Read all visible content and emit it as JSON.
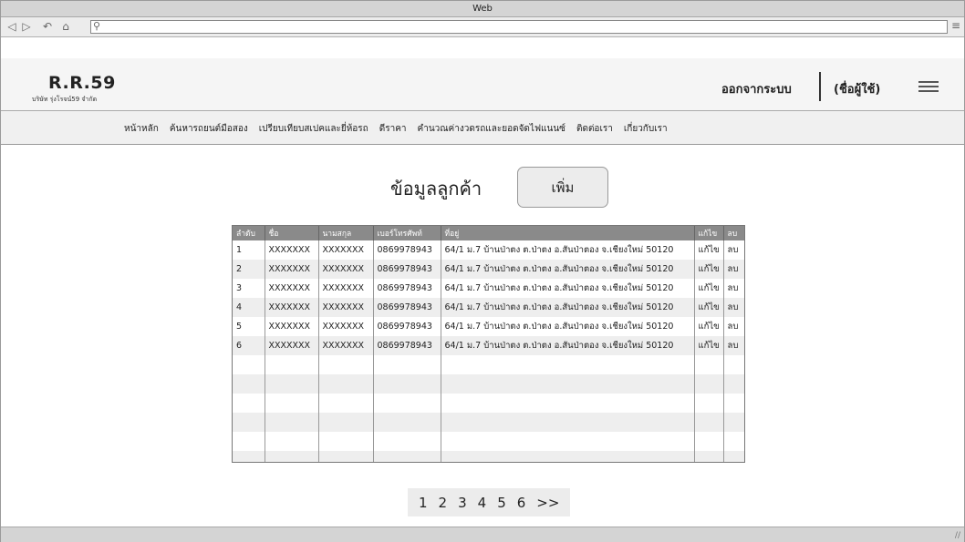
{
  "window": {
    "title": "Web"
  },
  "urlbar": {
    "value": ""
  },
  "header": {
    "logo_title": "R.R.59",
    "logo_subtitle": "บริษัท รุ่งโรจน์59 จำกัด",
    "logout_label": "ออกจากระบบ",
    "username_label": "(ชื่อผู้ใช้)"
  },
  "nav": {
    "items": [
      {
        "label": "หน้าหลัก"
      },
      {
        "label": "ค้นหารถยนต์มือสอง"
      },
      {
        "label": "เปรียบเทียบสเปคและยี่ห้อรถ"
      },
      {
        "label": "ดีราคา"
      },
      {
        "label": "คำนวณค่างวดรถและยอดจัดไฟแนนซ์"
      },
      {
        "label": "ติดต่อเรา"
      },
      {
        "label": "เกี่ยวกับเรา"
      }
    ]
  },
  "main": {
    "title": "ข้อมูลลูกค้า",
    "add_button_label": "เพิ่ม"
  },
  "table": {
    "columns": [
      "ลำดับ",
      "ชื่อ",
      "นามสกุล",
      "เบอร์โทรศัพท์",
      "ที่อยู่",
      "แก้ไข",
      "ลบ"
    ],
    "rows": [
      [
        "1",
        "XXXXXXX",
        "XXXXXXX",
        "0869978943",
        "64/1 ม.7 บ้านป่าตง ต.ป่าตง อ.สันป่าตอง จ.เชียงใหม่ 50120",
        "แก้ไข",
        "ลบ"
      ],
      [
        "2",
        "XXXXXXX",
        "XXXXXXX",
        "0869978943",
        "64/1 ม.7 บ้านป่าตง ต.ป่าตง อ.สันป่าตอง จ.เชียงใหม่ 50120",
        "แก้ไข",
        "ลบ"
      ],
      [
        "3",
        "XXXXXXX",
        "XXXXXXX",
        "0869978943",
        "64/1 ม.7 บ้านป่าตง ต.ป่าตง อ.สันป่าตอง จ.เชียงใหม่ 50120",
        "แก้ไข",
        "ลบ"
      ],
      [
        "4",
        "XXXXXXX",
        "XXXXXXX",
        "0869978943",
        "64/1 ม.7 บ้านป่าตง ต.ป่าตง อ.สันป่าตอง จ.เชียงใหม่ 50120",
        "แก้ไข",
        "ลบ"
      ],
      [
        "5",
        "XXXXXXX",
        "XXXXXXX",
        "0869978943",
        "64/1 ม.7 บ้านป่าตง ต.ป่าตง อ.สันป่าตอง จ.เชียงใหม่ 50120",
        "แก้ไข",
        "ลบ"
      ],
      [
        "6",
        "XXXXXXX",
        "XXXXXXX",
        "0869978943",
        "64/1 ม.7 บ้านป่าตง ต.ป่าตง อ.สันป่าตอง จ.เชียงใหม่ 50120",
        "แก้ไข",
        "ลบ"
      ]
    ]
  },
  "pagination": {
    "pages": [
      "1",
      "2",
      "3",
      "4",
      "5",
      "6"
    ],
    "next_label": ">>"
  },
  "icons": {
    "back": "arrow-left-icon",
    "forward": "arrow-right-icon",
    "reload": "reload-icon",
    "home": "home-icon",
    "search": "search-icon",
    "browser_menu": "menu-icon",
    "site_menu": "hamburger-icon"
  }
}
